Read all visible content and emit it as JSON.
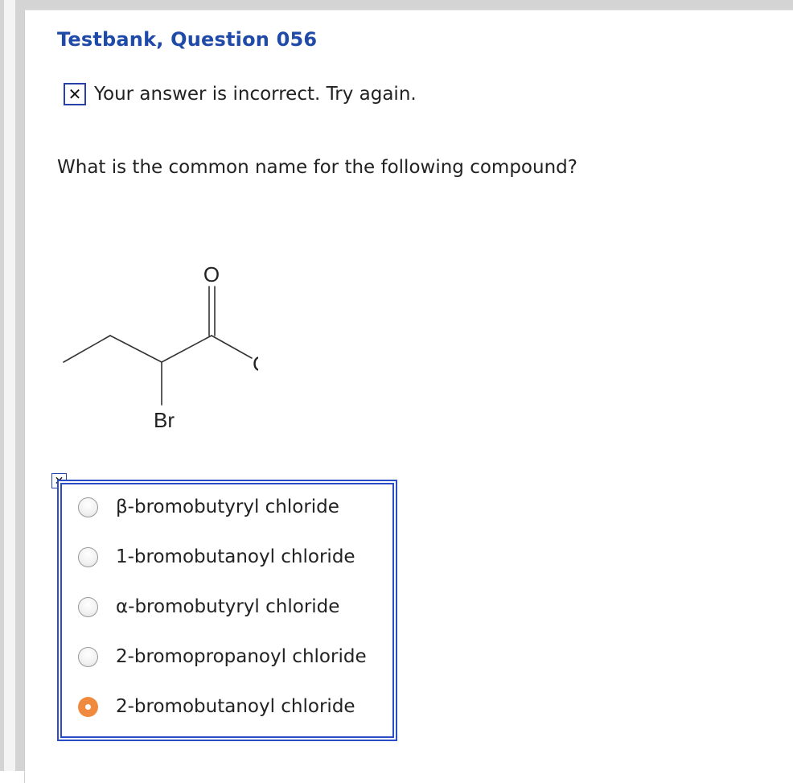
{
  "question_title": "Testbank, Question 056",
  "feedback": {
    "icon": "x-mark-icon",
    "text": "Your answer is incorrect.  Try again."
  },
  "question_text": "What is the common name for the following compound?",
  "molecule": {
    "labels": {
      "oxygen": "O",
      "chlorine": "Cl",
      "bromine": "Br"
    }
  },
  "answer_status_icon": "x-mark-icon",
  "options": [
    {
      "label": "β-bromobutyryl chloride",
      "selected": false
    },
    {
      "label": "1-bromobutanoyl chloride",
      "selected": false
    },
    {
      "label": "α-bromobutyryl chloride",
      "selected": false
    },
    {
      "label": "2-bromopropanoyl chloride",
      "selected": false
    },
    {
      "label": "2-bromobutanoyl chloride",
      "selected": true
    }
  ],
  "colors": {
    "title": "#1f4aa8",
    "answer_border": "#2a4cc7",
    "selected_radio": "#f08a3f"
  }
}
